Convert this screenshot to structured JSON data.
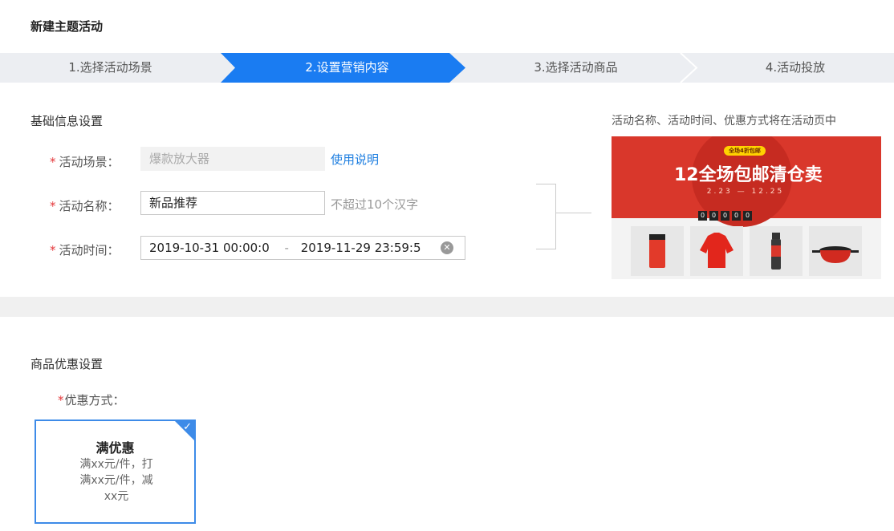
{
  "page_title": "新建主题活动",
  "steps": [
    {
      "label": "1.选择活动场景"
    },
    {
      "label": "2.设置营销内容"
    },
    {
      "label": "3.选择活动商品"
    },
    {
      "label": "4.活动投放"
    }
  ],
  "colors": {
    "accent": "#1a7cf2",
    "step_inactive": "#eceef2",
    "required": "#e4393c",
    "banner": "#d9372b"
  },
  "basic_info": {
    "title": "基础信息设置",
    "scene": {
      "label": "活动场景：",
      "value": "爆款放大器",
      "help_link": "使用说明"
    },
    "name": {
      "label": "活动名称：",
      "value": "新品推荐",
      "hint": "不超过10个汉字"
    },
    "time": {
      "label": "活动时间：",
      "start": "2019-10-31 00:00:0",
      "separator": "-",
      "end": "2019-11-29 23:59:5"
    }
  },
  "preview": {
    "note": "活动名称、活动时间、优惠方式将在活动页中",
    "banner_tag": "全场4折包邮",
    "banner_title": "12全场包邮清仓卖",
    "banner_dates": "2.23 — 12.25",
    "countdown": [
      "0",
      "0",
      "0",
      "0",
      "0"
    ],
    "products": [
      {
        "icon": "power-bank-icon"
      },
      {
        "icon": "jacket-icon"
      },
      {
        "icon": "bottle-icon"
      },
      {
        "icon": "pot-icon"
      }
    ]
  },
  "discount": {
    "title": "商品优惠设置",
    "method_label": "优惠方式：",
    "option": {
      "title": "满优惠",
      "desc_line1": "满xx元/件，打",
      "desc_line2": "满xx元/件，减",
      "desc_line3": "xx元",
      "selected": true
    }
  }
}
